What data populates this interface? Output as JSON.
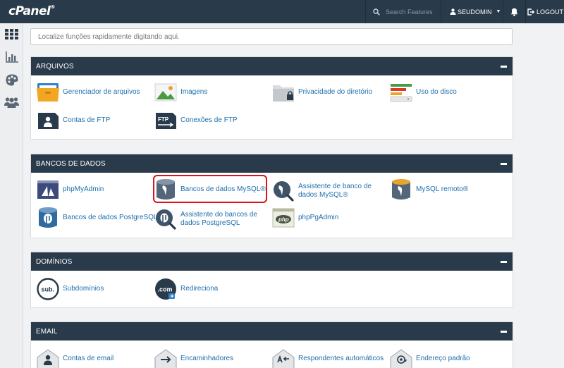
{
  "topbar": {
    "logo": "cPanel",
    "logo_mark": "®",
    "search_placeholder": "Search Features",
    "user": "SEUDOMIN",
    "logout": "LOGOUT"
  },
  "quick_search_placeholder": "Localize funções rapidamente digitando aqui.",
  "sections": {
    "arquivos": {
      "title": "ARQUIVOS",
      "items": [
        "Gerenciador de arquivos",
        "Imagens",
        "Privacidade do diretório",
        "Uso do disco",
        "Contas de FTP",
        "Conexões de FTP"
      ]
    },
    "bancos": {
      "title": "BANCOS DE DADOS",
      "items": [
        "phpMyAdmin",
        "Bancos de dados MySQL®",
        "Assistente de banco de dados MySQL®",
        "MySQL remoto®",
        "Bancos de dados PostgreSQL",
        "Assistente do bancos de dados PostgreSQL",
        "phpPgAdmin"
      ]
    },
    "dominios": {
      "title": "DOMÍNIOS",
      "items": [
        "Subdomínios",
        "Redireciona"
      ],
      "icon_text": [
        "sub.",
        ".com"
      ]
    },
    "email": {
      "title": "EMAIL",
      "items": [
        "Contas de email",
        "Encaminhadores",
        "Respondentes automáticos",
        "Endereço padrão"
      ]
    }
  },
  "icon_text": {
    "ftp": "FTP",
    "php": "php"
  },
  "colors": {
    "topbar": "#293a4a",
    "link": "#1e6fad",
    "highlight": "#d9141b"
  }
}
